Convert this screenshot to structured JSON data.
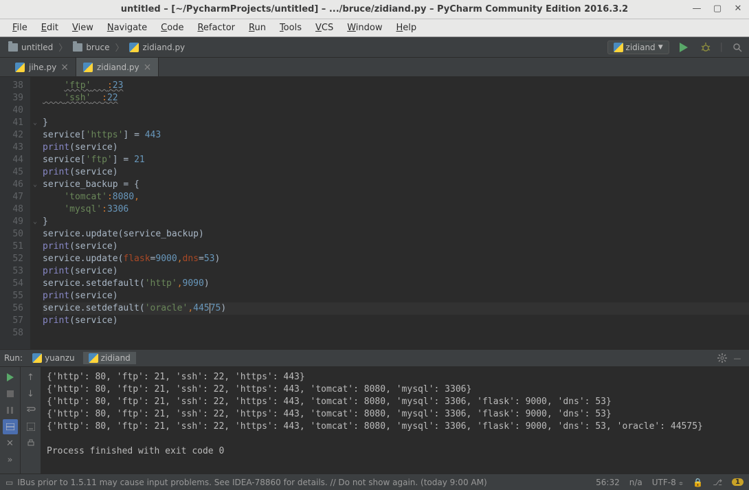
{
  "window": {
    "title": "untitled – [~/PycharmProjects/untitled] – .../bruce/zidiand.py – PyCharm Community Edition 2016.3.2"
  },
  "menu": [
    "File",
    "Edit",
    "View",
    "Navigate",
    "Code",
    "Refactor",
    "Run",
    "Tools",
    "VCS",
    "Window",
    "Help"
  ],
  "breadcrumbs": {
    "project": "untitled",
    "folder": "bruce",
    "file": "zidiand.py"
  },
  "run_config_selected": "zidiand",
  "tabs": [
    {
      "label": "jihe.py",
      "active": false
    },
    {
      "label": "zidiand.py",
      "active": true
    }
  ],
  "editor": {
    "first_line": 38,
    "lines": [
      {
        "n": 38,
        "fold": "",
        "html": "    <span class='wavy'><span class='s'>'ftp'</span>   <span class='k'>:</span><span class='n'>23</span></span>"
      },
      {
        "n": 39,
        "fold": "",
        "html": "<span class='wavy'>    <span class='s'>'ssh'</span>  <span class='k'>:</span><span class='n'>22</span></span>"
      },
      {
        "n": 40,
        "fold": "",
        "html": ""
      },
      {
        "n": 41,
        "fold": "⌄",
        "html": "}"
      },
      {
        "n": 42,
        "fold": "",
        "html": "service[<span class='s'>'https'</span>] = <span class='n'>443</span>"
      },
      {
        "n": 43,
        "fold": "",
        "html": "<span class='bi'>print</span>(service)"
      },
      {
        "n": 44,
        "fold": "",
        "html": "service[<span class='s'>'ftp'</span>] = <span class='n'>21</span>"
      },
      {
        "n": 45,
        "fold": "",
        "html": "<span class='bi'>print</span>(service)"
      },
      {
        "n": 46,
        "fold": "⌄",
        "html": "service_backup = {"
      },
      {
        "n": 47,
        "fold": "",
        "html": "    <span class='s'>'tomcat'</span><span class='k'>:</span><span class='n'>8080</span><span class='k'>,</span>"
      },
      {
        "n": 48,
        "fold": "",
        "html": "    <span class='s'>'mysql'</span><span class='k'>:</span><span class='n'>3306</span>"
      },
      {
        "n": 49,
        "fold": "⌄",
        "html": "}"
      },
      {
        "n": 50,
        "fold": "",
        "html": "service.update(service_backup)"
      },
      {
        "n": 51,
        "fold": "",
        "html": "<span class='bi'>print</span>(service)"
      },
      {
        "n": 52,
        "fold": "",
        "html": "service.update(<span class='kw'>flask</span>=<span class='n'>9000</span><span class='k'>,</span><span class='kw'>dns</span>=<span class='n'>53</span>)"
      },
      {
        "n": 53,
        "fold": "",
        "html": "<span class='bi'>print</span>(service)"
      },
      {
        "n": 54,
        "fold": "",
        "html": "service.setdefault(<span class='s'>'http'</span><span class='k'>,</span><span class='n'>9090</span>)"
      },
      {
        "n": 55,
        "fold": "",
        "html": "<span class='bi'>print</span>(service)"
      },
      {
        "n": 56,
        "fold": "",
        "html": "service.setdefault(<span class='s'>'oracle'</span><span class='k'>,</span><span class='n'>445</span><span class='caret'></span><span class='n'>75</span>)"
      },
      {
        "n": 57,
        "fold": "",
        "html": "<span class='bi'>print</span>(service)"
      },
      {
        "n": 58,
        "fold": "",
        "html": ""
      }
    ],
    "highlight_line": 56
  },
  "run_panel": {
    "label": "Run:",
    "tabs": [
      {
        "label": "yuanzu",
        "active": false
      },
      {
        "label": "zidiand",
        "active": true
      }
    ],
    "output": [
      "{'http': 80, 'ftp': 21, 'ssh': 22, 'https': 443}",
      "{'http': 80, 'ftp': 21, 'ssh': 22, 'https': 443, 'tomcat': 8080, 'mysql': 3306}",
      "{'http': 80, 'ftp': 21, 'ssh': 22, 'https': 443, 'tomcat': 8080, 'mysql': 3306, 'flask': 9000, 'dns': 53}",
      "{'http': 80, 'ftp': 21, 'ssh': 22, 'https': 443, 'tomcat': 8080, 'mysql': 3306, 'flask': 9000, 'dns': 53}",
      "{'http': 80, 'ftp': 21, 'ssh': 22, 'https': 443, 'tomcat': 8080, 'mysql': 3306, 'flask': 9000, 'dns': 53, 'oracle': 44575}",
      "",
      "Process finished with exit code 0"
    ]
  },
  "status": {
    "message": "IBus prior to 1.5.11 may cause input problems. See IDEA-78860 for details. // Do not show again. (today 9:00 AM)",
    "pos": "56:32",
    "insert": "n/a",
    "encoding": "UTF-8",
    "lock": "🔒",
    "badge": "1"
  }
}
